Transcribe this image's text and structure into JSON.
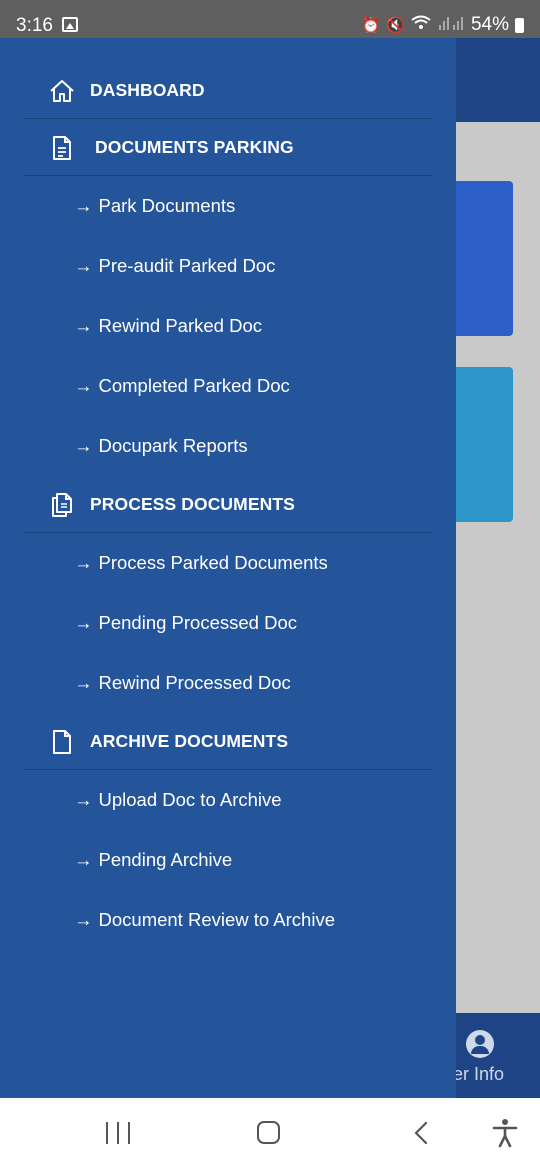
{
  "status_bar": {
    "time": "3:16",
    "battery": "54%",
    "icons": [
      "gallery-icon",
      "alarm-icon",
      "mute-icon",
      "wifi-icon",
      "signal-icon",
      "battery-icon"
    ]
  },
  "background": {
    "user_info_label": "ser Info"
  },
  "drawer": {
    "dashboard": {
      "label": "DASHBOARD",
      "icon": "home-icon"
    },
    "sections": [
      {
        "title": "DOCUMENTS PARKING",
        "icon": "document-icon",
        "items": [
          "Park Documents",
          "Pre-audit Parked Doc",
          "Rewind Parked Doc",
          "Completed Parked Doc",
          "Docupark Reports"
        ]
      },
      {
        "title": "PROCESS DOCUMENTS",
        "icon": "copy-document-icon",
        "items": [
          "Process Parked Documents",
          "Pending Processed Doc",
          "Rewind Processed Doc"
        ]
      },
      {
        "title": "ARCHIVE DOCUMENTS",
        "icon": "file-icon",
        "items": [
          "Upload Doc to Archive",
          "Pending Archive",
          "Document Review to Archive"
        ]
      }
    ],
    "arrow": "→"
  },
  "colors": {
    "drawer": "#24549a",
    "app_header": "#1f4486",
    "card_blue": "#2d5fc8",
    "card_cyan": "#2d95c8"
  }
}
